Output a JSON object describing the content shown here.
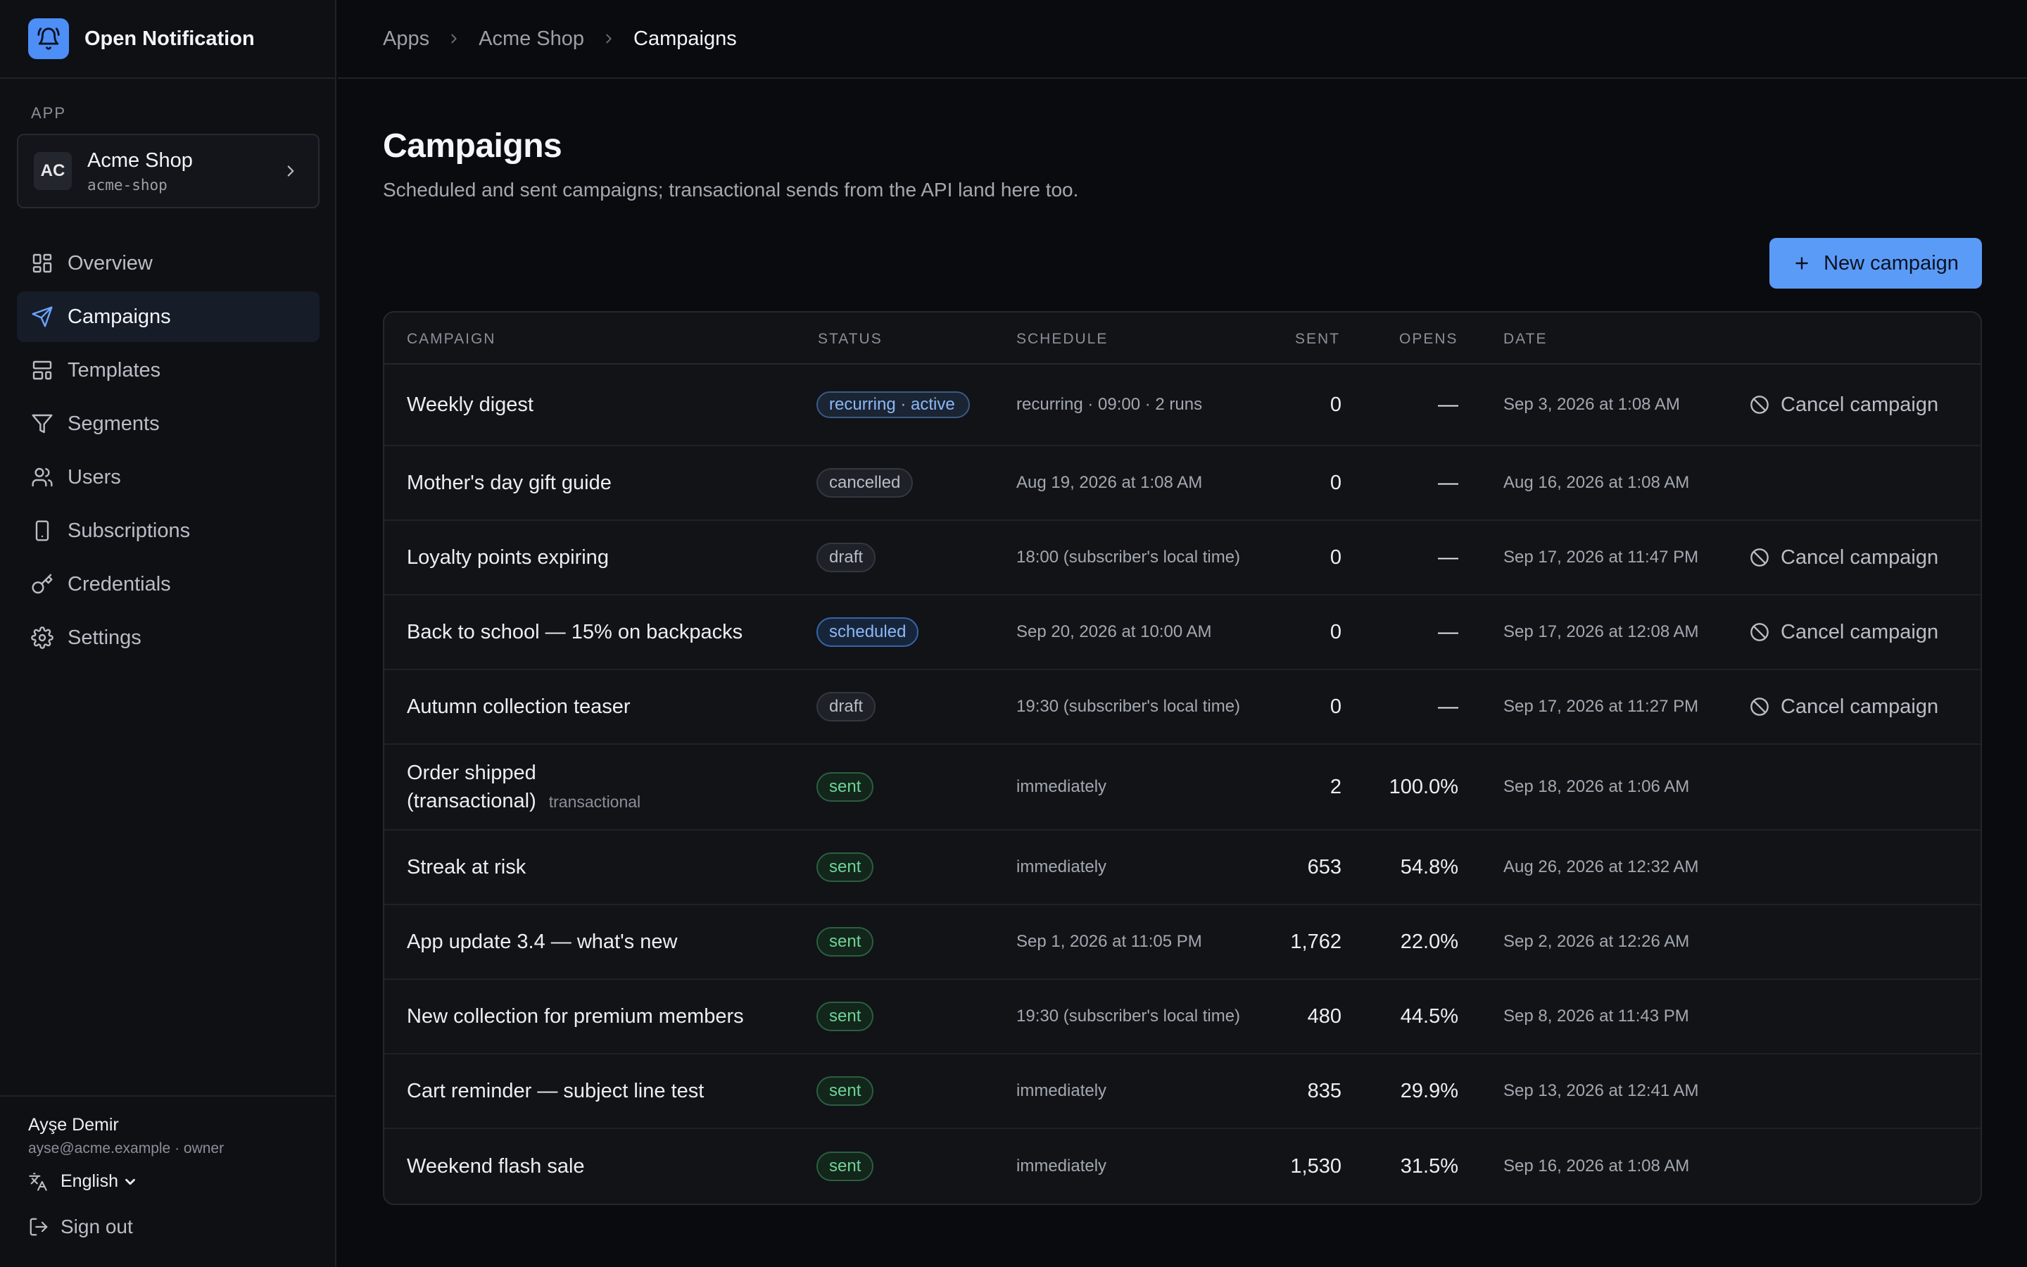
{
  "brand": {
    "name": "Open Notification"
  },
  "sidebar": {
    "section_label": "APP",
    "app": {
      "initials": "AC",
      "name": "Acme Shop",
      "slug": "acme-shop"
    },
    "nav": [
      {
        "label": "Overview",
        "icon": "grid-icon",
        "active": false
      },
      {
        "label": "Campaigns",
        "icon": "send-icon",
        "active": true
      },
      {
        "label": "Templates",
        "icon": "layout-template-icon",
        "active": false
      },
      {
        "label": "Segments",
        "icon": "filter-icon",
        "active": false
      },
      {
        "label": "Users",
        "icon": "users-icon",
        "active": false
      },
      {
        "label": "Subscriptions",
        "icon": "smartphone-icon",
        "active": false
      },
      {
        "label": "Credentials",
        "icon": "key-icon",
        "active": false
      },
      {
        "label": "Settings",
        "icon": "gear-icon",
        "active": false
      }
    ],
    "user": {
      "name": "Ayşe Demir",
      "meta": "ayse@acme.example · owner"
    },
    "language": "English",
    "sign_out": "Sign out"
  },
  "breadcrumb": {
    "items": [
      "Apps",
      "Acme Shop",
      "Campaigns"
    ]
  },
  "page": {
    "title": "Campaigns",
    "subtitle": "Scheduled and sent campaigns; transactional sends from the API land here too.",
    "new_button": "New campaign"
  },
  "table": {
    "headers": {
      "campaign": "CAMPAIGN",
      "status": "STATUS",
      "schedule": "SCHEDULE",
      "sent": "SENT",
      "opens": "OPENS",
      "date": "DATE"
    },
    "action_label": "Cancel campaign",
    "rows": [
      {
        "name": "Weekly digest",
        "tag": "",
        "status": "recurring · active",
        "status_kind": "recurring",
        "schedule": "recurring · 09:00 · 2 runs",
        "sent": "0",
        "opens": "—",
        "date": "Sep 3, 2026 at 1:08 AM",
        "cancel": true
      },
      {
        "name": "Mother's day gift guide",
        "tag": "",
        "status": "cancelled",
        "status_kind": "cancelled",
        "schedule": "Aug 19, 2026 at 1:08 AM",
        "sent": "0",
        "opens": "—",
        "date": "Aug 16, 2026 at 1:08 AM",
        "cancel": false
      },
      {
        "name": "Loyalty points expiring",
        "tag": "",
        "status": "draft",
        "status_kind": "draft",
        "schedule": "18:00 (subscriber's local time)",
        "sent": "0",
        "opens": "—",
        "date": "Sep 17, 2026 at 11:47 PM",
        "cancel": true
      },
      {
        "name": "Back to school — 15% on backpacks",
        "tag": "",
        "status": "scheduled",
        "status_kind": "scheduled",
        "schedule": "Sep 20, 2026 at 10:00 AM",
        "sent": "0",
        "opens": "—",
        "date": "Sep 17, 2026 at 12:08 AM",
        "cancel": true
      },
      {
        "name": "Autumn collection teaser",
        "tag": "",
        "status": "draft",
        "status_kind": "draft",
        "schedule": "19:30 (subscriber's local time)",
        "sent": "0",
        "opens": "—",
        "date": "Sep 17, 2026 at 11:27 PM",
        "cancel": true
      },
      {
        "name": "Order shipped (transactional)",
        "tag": "transactional",
        "status": "sent",
        "status_kind": "sent",
        "schedule": "immediately",
        "sent": "2",
        "opens": "100.0%",
        "date": "Sep 18, 2026 at 1:06 AM",
        "cancel": false
      },
      {
        "name": "Streak at risk",
        "tag": "",
        "status": "sent",
        "status_kind": "sent",
        "schedule": "immediately",
        "sent": "653",
        "opens": "54.8%",
        "date": "Aug 26, 2026 at 12:32 AM",
        "cancel": false
      },
      {
        "name": "App update 3.4 — what's new",
        "tag": "",
        "status": "sent",
        "status_kind": "sent",
        "schedule": "Sep 1, 2026 at 11:05 PM",
        "sent": "1,762",
        "opens": "22.0%",
        "date": "Sep 2, 2026 at 12:26 AM",
        "cancel": false
      },
      {
        "name": "New collection for premium members",
        "tag": "",
        "status": "sent",
        "status_kind": "sent",
        "schedule": "19:30 (subscriber's local time)",
        "sent": "480",
        "opens": "44.5%",
        "date": "Sep 8, 2026 at 11:43 PM",
        "cancel": false
      },
      {
        "name": "Cart reminder — subject line test",
        "tag": "",
        "status": "sent",
        "status_kind": "sent",
        "schedule": "immediately",
        "sent": "835",
        "opens": "29.9%",
        "date": "Sep 13, 2026 at 12:41 AM",
        "cancel": false
      },
      {
        "name": "Weekend flash sale",
        "tag": "",
        "status": "sent",
        "status_kind": "sent",
        "schedule": "immediately",
        "sent": "1,530",
        "opens": "31.5%",
        "date": "Sep 16, 2026 at 1:08 AM",
        "cancel": false
      }
    ]
  },
  "colors": {
    "accent": "#5b9bf8",
    "sent": "#6fd398",
    "scheduled": "#8cb8f6"
  }
}
